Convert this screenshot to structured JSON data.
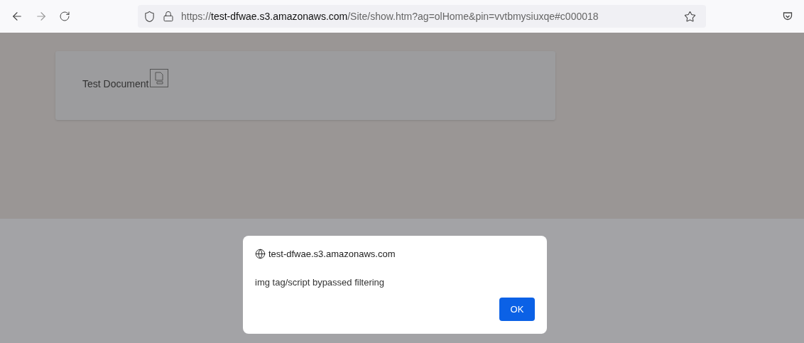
{
  "address_bar": {
    "scheme": "https://",
    "host": "test-dfwae.s3.amazonaws.com",
    "path": "/Site/show.htm?ag=olHome&pin=vvtbmysiuxqe#c000018"
  },
  "page": {
    "card_text": "Test Document"
  },
  "alert": {
    "origin": "test-dfwae.s3.amazonaws.com",
    "message": "img tag/script bypassed filtering",
    "button": "OK"
  }
}
